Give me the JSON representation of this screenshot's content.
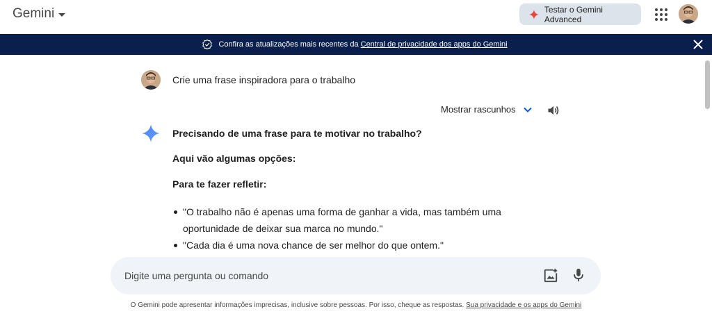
{
  "header": {
    "brand": "Gemini",
    "advanced_button": "Testar o Gemini Advanced"
  },
  "banner": {
    "text": "Confira as atualizações mais recentes da ",
    "link": "Central de privacidade dos apps do Gemini"
  },
  "conversation": {
    "user_prompt": "Crie uma frase inspiradora para o trabalho",
    "drafts_label": "Mostrar rascunhos",
    "response": {
      "heading": "Precisando de uma frase para te motivar no trabalho?",
      "intro": "Aqui vão algumas opções:",
      "section_title": "Para te fazer refletir:",
      "bullets": [
        "\"O trabalho não é apenas uma forma de ganhar a vida, mas também uma oportunidade de deixar sua marca no mundo.\"",
        "\"Cada dia é uma nova chance de ser melhor do que ontem.\""
      ]
    }
  },
  "input": {
    "placeholder": "Digite uma pergunta ou comando"
  },
  "footer": {
    "disclaimer": "O Gemini pode apresentar informações imprecisas, inclusive sobre pessoas. Por isso, cheque as respostas. ",
    "link": "Sua privacidade e os apps do Gemini"
  },
  "colors": {
    "banner_bg": "#0b1f4c",
    "advanced_bg": "#dde3ea",
    "input_bg": "#f0f4f9",
    "accent_blue": "#0b57d0",
    "sparkle_red": "#e8453c"
  },
  "icons": [
    "caret-down-icon",
    "sparkle-icon",
    "apps-grid-icon",
    "verified-check-icon",
    "close-icon",
    "chevron-down-icon",
    "speaker-icon",
    "gemini-sparkle-icon",
    "add-image-icon",
    "mic-icon"
  ]
}
